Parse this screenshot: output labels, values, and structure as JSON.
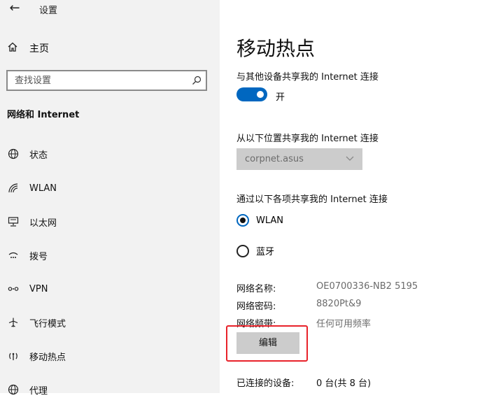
{
  "window": {
    "back_glyph": "←",
    "title": "设置"
  },
  "sidebar": {
    "home_label": "主页",
    "search_placeholder": "查找设置",
    "section_title": "网络和 Internet",
    "items": [
      {
        "label": "状态",
        "icon": "globe-icon"
      },
      {
        "label": "WLAN",
        "icon": "wifi-icon"
      },
      {
        "label": "以太网",
        "icon": "ethernet-icon"
      },
      {
        "label": "拨号",
        "icon": "dialup-icon"
      },
      {
        "label": "VPN",
        "icon": "vpn-icon"
      },
      {
        "label": "飞行模式",
        "icon": "airplane-icon"
      },
      {
        "label": "移动热点",
        "icon": "hotspot-icon"
      },
      {
        "label": "代理",
        "icon": "proxy-globe-icon"
      }
    ]
  },
  "main": {
    "title": "移动热点",
    "share_label": "与其他设备共享我的 Internet 连接",
    "toggle_state": "开",
    "share_from_label": "从以下位置共享我的 Internet 连接",
    "share_from_value": "corpnet.asus",
    "share_over_label": "通过以下各项共享我的 Internet 连接",
    "share_over_options": [
      {
        "label": "WLAN",
        "selected": true
      },
      {
        "label": "蓝牙",
        "selected": false
      }
    ],
    "props": [
      {
        "key": "网络名称:",
        "value": "OE0700336-NB2 5195"
      },
      {
        "key": "网络密码:",
        "value": "8820Pt&9"
      },
      {
        "key": "网络频带:",
        "value": "任何可用频率"
      }
    ],
    "edit_label": "编辑",
    "connected_label": "已连接的设备:",
    "connected_value": "0 台(共 8 台)"
  },
  "colors": {
    "accent": "#0067c0",
    "sidebar_bg": "#f2f2f2",
    "highlight": "#e8222a"
  }
}
